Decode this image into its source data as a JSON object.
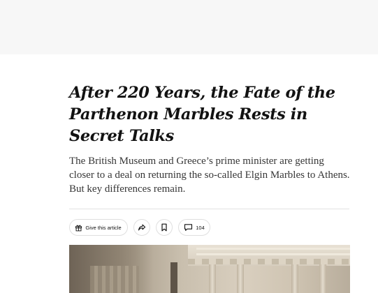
{
  "article": {
    "headline": "After 220 Years, the Fate of the Parthenon Marbles Rests in Secret Talks",
    "summary": "The British Museum and Greece’s prime minister are getting closer to a deal on returning the so-called Elgin Marbles to Athens. But key differences remain."
  },
  "toolbar": {
    "gift_label": "Give this article",
    "gift_icon": "gift-icon",
    "share_icon": "share-icon",
    "save_icon": "bookmark-icon",
    "comments_icon": "comment-icon",
    "comments_count": "104"
  },
  "colors": {
    "headline": "#121212",
    "summary": "#363636",
    "top_band": "#f7f7f7",
    "divider": "#e2e2e2"
  }
}
